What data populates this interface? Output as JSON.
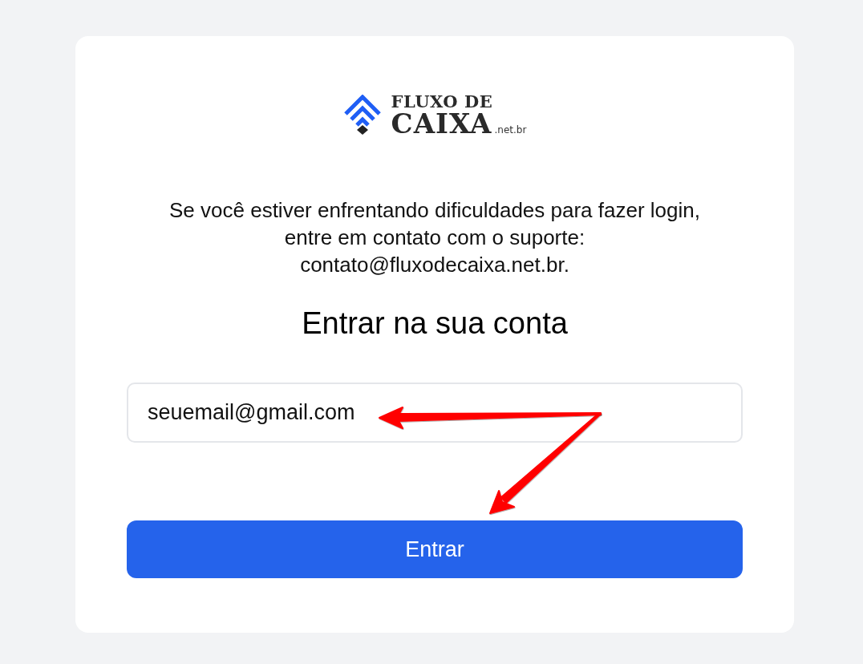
{
  "logo": {
    "line_1": "FLUXO DE",
    "line_2": "CAIXA",
    "suffix": ".net.br"
  },
  "notice": {
    "lines": [
      "Se você estiver enfrentando dificuldades para fazer login,",
      "entre em contato com o suporte:",
      "contato@fluxodecaixa.net.br."
    ]
  },
  "heading": "Entrar na sua conta",
  "email_field": {
    "value": "seuemail@gmail.com"
  },
  "login_button": {
    "label": "Entrar"
  }
}
